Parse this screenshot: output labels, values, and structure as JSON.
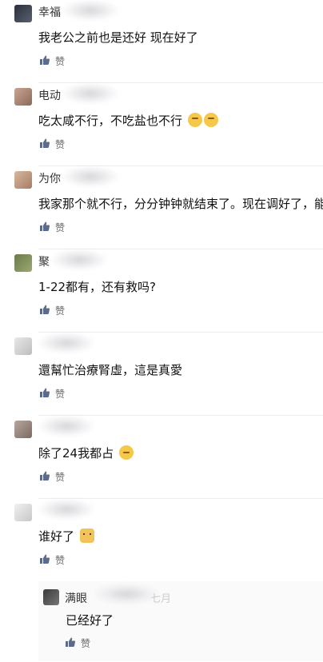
{
  "colors": {
    "text": "#111111",
    "name": "#333333",
    "muted": "#666666",
    "separator": "#ececec",
    "emoji": "#f5c84a"
  },
  "like_label": "赞",
  "comments": [
    {
      "name": "幸福",
      "text": "我老公之前也是还好 现在好了",
      "emoji": ""
    },
    {
      "name": "电动",
      "text": "吃太咸不行，不吃盐也不行",
      "emoji": "thinking-face-icon"
    },
    {
      "name": "为你",
      "text": "我家那个就不行，分分钟钟就结束了。现在调好了，能",
      "emoji": ""
    },
    {
      "name": "聚",
      "text": "1-22都有，还有救吗?",
      "emoji": ""
    },
    {
      "name": "",
      "text": "還幫忙治療腎虛，這是真愛",
      "emoji": ""
    },
    {
      "name": "",
      "text": "除了24我都占",
      "emoji": "sleepy-face-icon"
    },
    {
      "name": "",
      "text": "谁好了",
      "emoji": "dog-face-icon"
    }
  ],
  "reply": {
    "name": "满眼",
    "mark": "七月",
    "text": "已经好了"
  }
}
